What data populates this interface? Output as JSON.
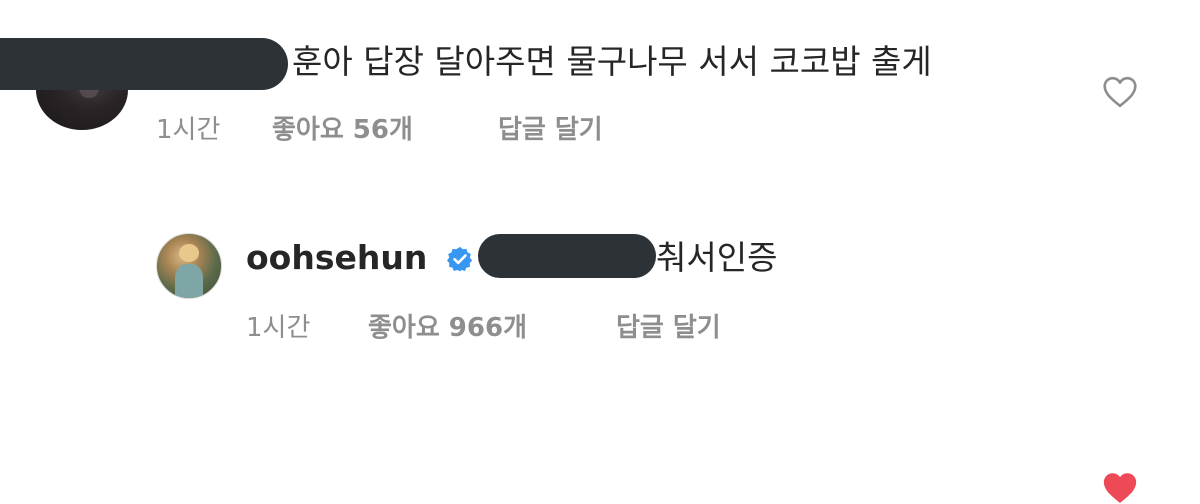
{
  "colors": {
    "text": "#262626",
    "meta_text": "#8e8e8e",
    "redaction": "#2c3236",
    "verified_blue": "#3897f0",
    "like_red": "#ed4956",
    "heart_outline": "#8e8e8e"
  },
  "comments": [
    {
      "username_redacted": true,
      "text": "훈아 답장 달아주면 물구나무 서서 코코밥 출게",
      "time": "1시간",
      "likes": "좋아요 56개",
      "reply": "답글 달기",
      "liked": false,
      "heart_icon": "heart-outline-icon"
    },
    {
      "username": "oohsehun",
      "verified": true,
      "verified_icon": "verified-badge-icon",
      "mention_redacted": true,
      "text": "춰서인증",
      "time": "1시간",
      "likes": "좋아요 966개",
      "reply": "답글 달기",
      "liked": true,
      "heart_icon": "heart-filled-icon"
    }
  ]
}
